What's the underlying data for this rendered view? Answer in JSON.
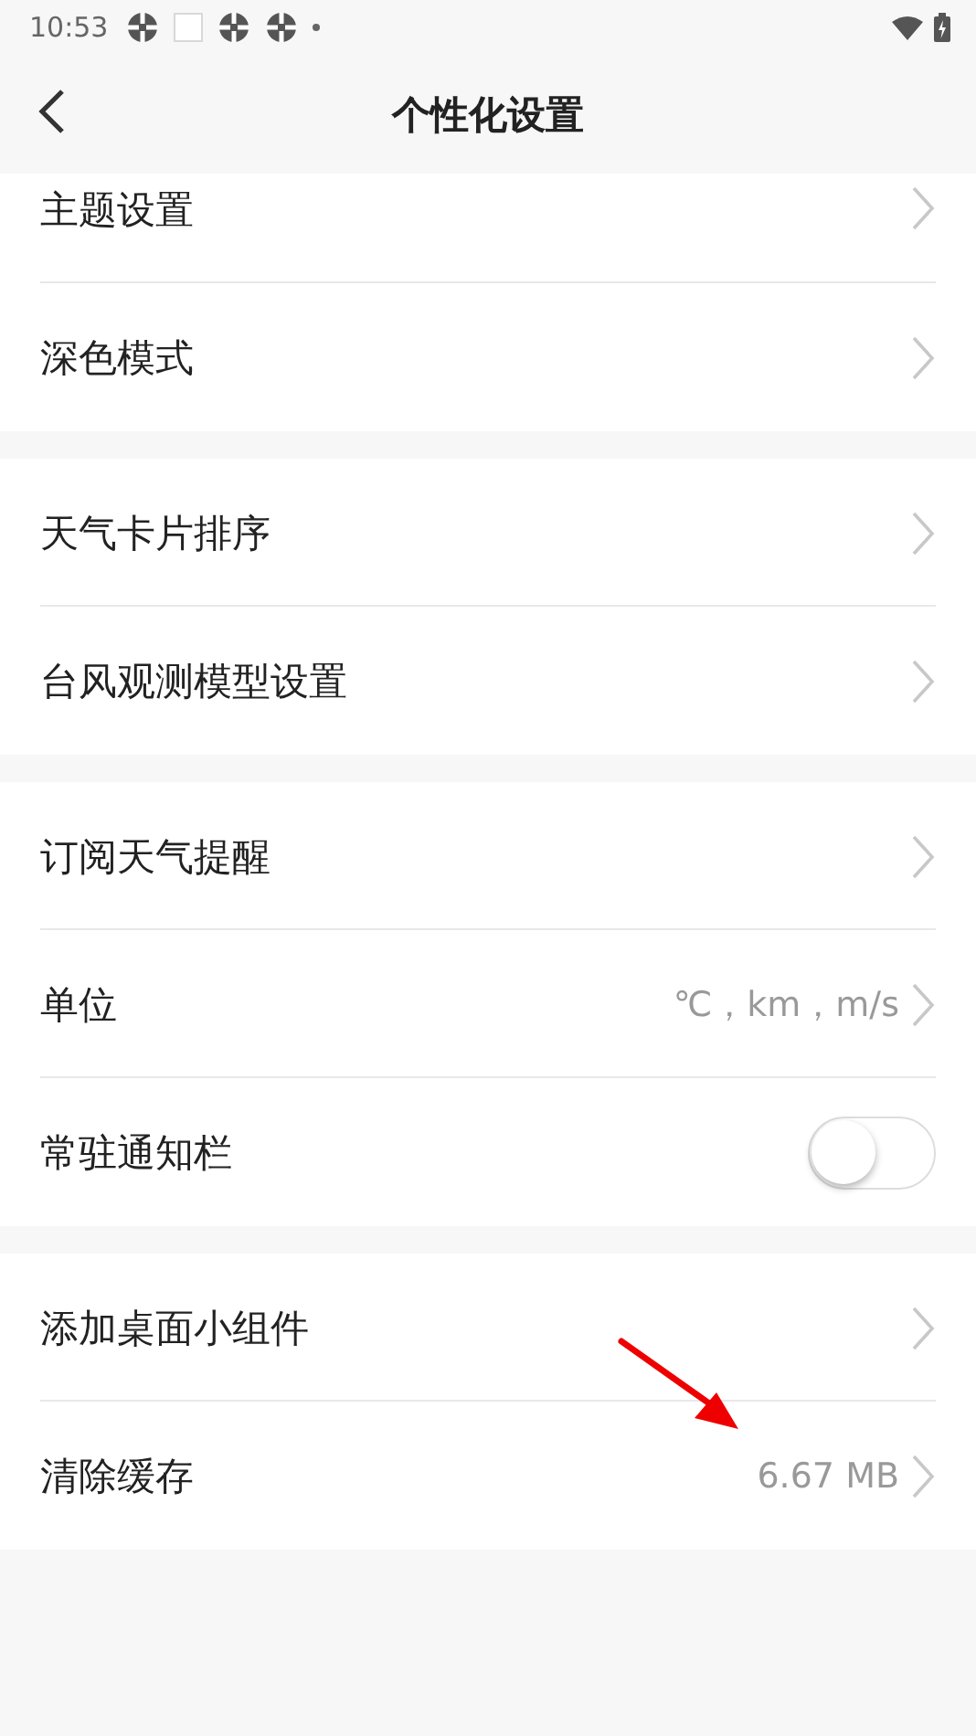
{
  "status_bar": {
    "time": "10:53"
  },
  "header": {
    "title": "个性化设置"
  },
  "groups": [
    {
      "items": [
        {
          "kind": "link",
          "label": "主题设置"
        },
        {
          "kind": "link",
          "label": "深色模式"
        }
      ]
    },
    {
      "items": [
        {
          "kind": "link",
          "label": "天气卡片排序"
        },
        {
          "kind": "link",
          "label": "台风观测模型设置"
        }
      ]
    },
    {
      "items": [
        {
          "kind": "link",
          "label": "订阅天气提醒"
        },
        {
          "kind": "link",
          "label": "单位",
          "value": "℃，km，m/s"
        },
        {
          "kind": "toggle",
          "label": "常驻通知栏",
          "on": false
        }
      ]
    },
    {
      "items": [
        {
          "kind": "link",
          "label": "添加桌面小组件"
        },
        {
          "kind": "link",
          "label": "清除缓存",
          "value": "6.67 MB"
        }
      ]
    }
  ]
}
